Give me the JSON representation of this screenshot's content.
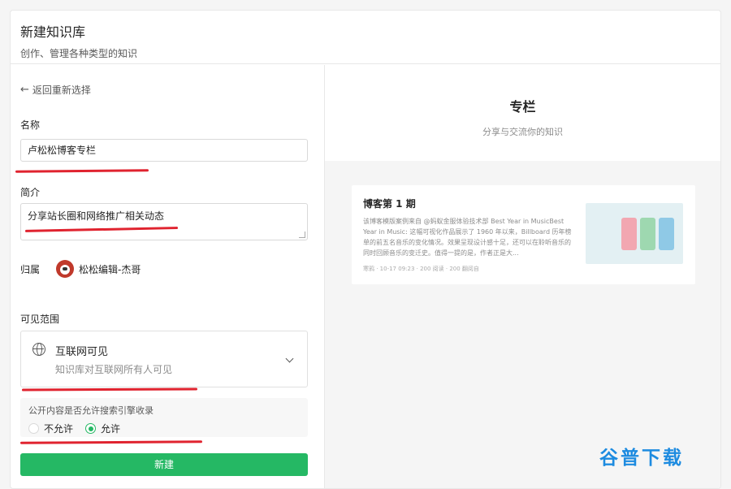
{
  "header": {
    "title": "新建知识库",
    "subtitle": "创作、管理各种类型的知识"
  },
  "form": {
    "back_label": "返回重新选择",
    "name_label": "名称",
    "name_value": "卢松松博客专栏",
    "intro_label": "简介",
    "intro_value": "分享站长圈和网络推广相关动态",
    "owner_label": "归属",
    "owner_name": "松松编辑-杰哥",
    "visibility_label": "可见范围",
    "visibility_title": "互联网可见",
    "visibility_desc": "知识库对互联网所有人可见",
    "seo_question": "公开内容是否允许搜索引擎收录",
    "seo_options": [
      "不允许",
      "允许"
    ],
    "seo_selected": "允许",
    "submit_label": "新建"
  },
  "preview": {
    "title": "专栏",
    "subtitle": "分享与交流你的知识",
    "post_title": "博客第 1 期",
    "post_desc": "该博客模版案例来自 @蚂蚁金服体验技术部 Best Year in MusicBest Year in Music: 这幅可视化作品展示了 1960 年以来，Billboard 历年榜单的前五名音乐的变化情况。效果呈现设计感十足，还可以在聆听音乐的同时回顾音乐的变迁史。值得一提的是，作者正是大...",
    "post_meta": "寒鸦 · 10-17 09:23 · 200 阅读 · 200 翻阅自"
  },
  "watermark": "谷普下载",
  "colors": {
    "accent": "#25b864",
    "annotation": "#e0232f",
    "watermark": "#1d8be0"
  }
}
